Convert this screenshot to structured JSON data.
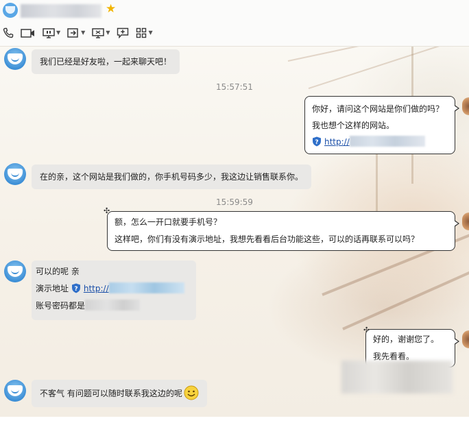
{
  "header": {
    "contact_name": "",
    "toolbar": [
      {
        "icon": "phone-icon",
        "has_menu": false
      },
      {
        "icon": "video-icon",
        "has_menu": false
      },
      {
        "icon": "remote-screen-icon",
        "has_menu": true
      },
      {
        "icon": "send-file-icon",
        "has_menu": true
      },
      {
        "icon": "share-screen-icon",
        "has_menu": true
      },
      {
        "icon": "add-chat-icon",
        "has_menu": false
      },
      {
        "icon": "apps-grid-icon",
        "has_menu": true
      }
    ]
  },
  "messages": {
    "m1": "我们已经是好友啦，一起来聊天吧！",
    "t1": "15:57:51",
    "m2_line1": "你好，请问这个网站是你们做的吗？",
    "m2_line2": "我也想个这样的网站。",
    "m2_link": "http://",
    "m3": "在的亲，这个网站是我们做的，你手机号码多少，我这边让销售联系你。",
    "t2": "15:59:59",
    "m4_line1": "额，怎么一开口就要手机号？",
    "m4_line2": "这样吧，你们有没有演示地址，我想先看看后台功能这些，可以的话再联系可以吗？",
    "m5_line1": "可以的呢 亲",
    "m5_line2_label": "演示地址",
    "m5_link": "http://",
    "m5_line3": "账号密码都是",
    "m6_line1": "好的，谢谢您了。",
    "m6_line2": "我先看看。",
    "m7": "不客气 有问题可以随时联系我这边的呢"
  },
  "colors": {
    "incoming_bubble": "#e9e8e6",
    "outgoing_bubble": "#ffffff",
    "link": "#1a4fa8",
    "timestamp": "#8a8a8a"
  }
}
